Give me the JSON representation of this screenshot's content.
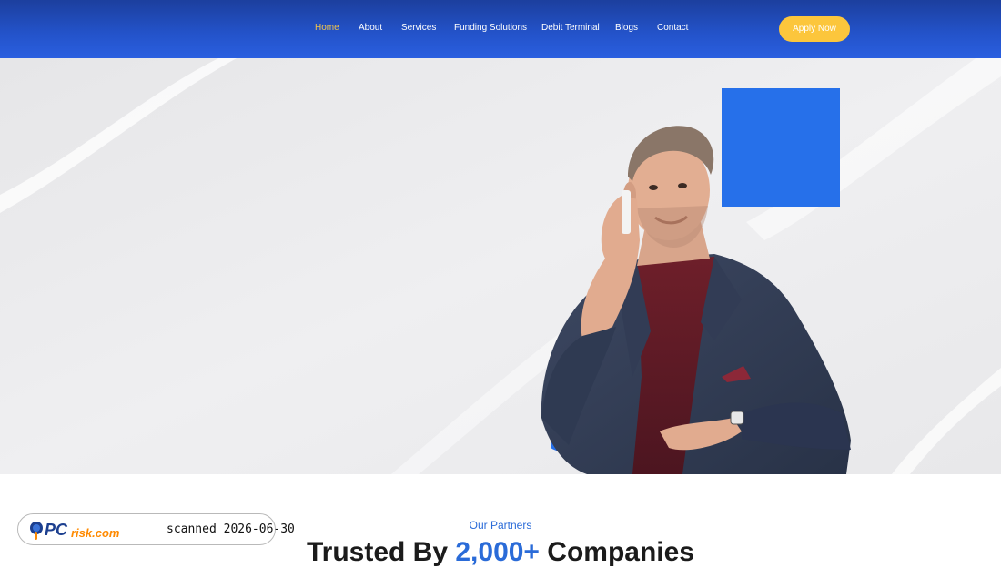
{
  "nav": {
    "items": [
      {
        "label": "Home",
        "active": true
      },
      {
        "label": "About"
      },
      {
        "label": "Services"
      },
      {
        "label": "Funding Solutions"
      },
      {
        "label": "Debit Terminal"
      },
      {
        "label": "Blogs"
      },
      {
        "label": "Contact"
      }
    ],
    "cta_label": "Apply Now"
  },
  "hero": {
    "image_subject": "businessman-on-phone-photo",
    "decoration": "blue-square"
  },
  "partners": {
    "eyebrow": "Our Partners",
    "headline_pre": "Trusted By ",
    "headline_accent": "2,000+",
    "headline_post": " Companies"
  },
  "watermark": {
    "logo_text": "PCrisk.com",
    "scan_text": "scanned 2026-06-30"
  },
  "colors": {
    "header": "#2352c8",
    "accent_yellow": "#fcc63c",
    "accent_blue": "#2a6bd8",
    "nav_active": "#f4c64a"
  }
}
